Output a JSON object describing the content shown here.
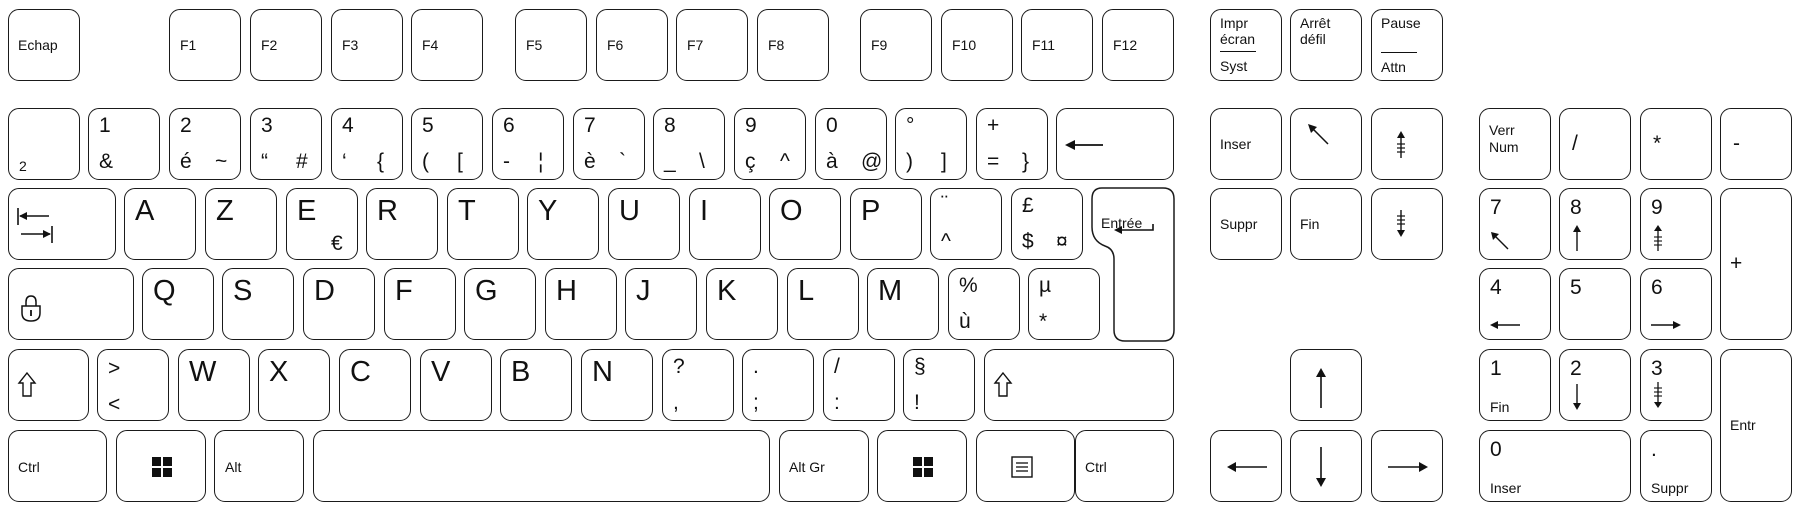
{
  "keyboard": {
    "fn_row": {
      "esc": "Echap",
      "f": [
        "F1",
        "F2",
        "F3",
        "F4",
        "F5",
        "F6",
        "F7",
        "F8",
        "F9",
        "F10",
        "F11",
        "F12"
      ],
      "print_top1": "Impr",
      "print_top2": "écran",
      "print_bottom": "Syst",
      "scroll1": "Arrêt",
      "scroll2": "défil",
      "pause_top": "Pause",
      "pause_bottom": "Attn"
    },
    "number_row": [
      {
        "top": "",
        "bl": "2",
        "br": ""
      },
      {
        "top": "1",
        "bl": "&",
        "br": ""
      },
      {
        "top": "2",
        "bl": "é",
        "br": "~"
      },
      {
        "top": "3",
        "bl": "“",
        "br": "#"
      },
      {
        "top": "4",
        "bl": "‘",
        "br": "{"
      },
      {
        "top": "5",
        "bl": "(",
        "br": "["
      },
      {
        "top": "6",
        "bl": "-",
        "br": "¦"
      },
      {
        "top": "7",
        "bl": "è",
        "br": "`"
      },
      {
        "top": "8",
        "bl": "_",
        "br": "\\"
      },
      {
        "top": "9",
        "bl": "ç",
        "br": "^"
      },
      {
        "top": "0",
        "bl": "à",
        "br": "@"
      },
      {
        "top": "°",
        "bl": ")",
        "br": "]"
      },
      {
        "top": "+",
        "bl": "=",
        "br": "}"
      }
    ],
    "row_azerty": {
      "letters": [
        "A",
        "Z",
        "E",
        "R",
        "T",
        "Y",
        "U",
        "I",
        "O",
        "P"
      ],
      "e_alt": "€",
      "trema_top": "¨",
      "trema_bottom": "^",
      "pound_top": "£",
      "pound_bl": "$",
      "pound_br": "¤",
      "enter": "Entrée"
    },
    "row_qsdf": {
      "letters": [
        "Q",
        "S",
        "D",
        "F",
        "G",
        "H",
        "J",
        "K",
        "L",
        "M"
      ],
      "pct_top": "%",
      "pct_bottom": "ù",
      "mu_top": "µ",
      "mu_bottom": "*"
    },
    "row_wxcv": {
      "angle_top": ">",
      "angle_bottom": "<",
      "letters": [
        "W",
        "X",
        "C",
        "V",
        "B",
        "N"
      ],
      "punct": [
        {
          "top": "?",
          "bottom": ","
        },
        {
          "top": ".",
          "bottom": ";"
        },
        {
          "top": "/",
          "bottom": ":"
        },
        {
          "top": "§",
          "bottom": "!"
        }
      ]
    },
    "bottom_row": {
      "ctrl_left": "Ctrl",
      "alt": "Alt",
      "altgr": "Alt Gr",
      "ctrl_right": "Ctrl"
    },
    "nav": {
      "insert": "Inser",
      "delete": "Suppr",
      "end": "Fin"
    },
    "numpad": {
      "numlock1": "Verr",
      "numlock2": "Num",
      "slash": "/",
      "star": "*",
      "minus": "-",
      "plus": "+",
      "enter": "Entr",
      "n7": "7",
      "n8": "8",
      "n9": "9",
      "n4": "4",
      "n5": "5",
      "n6": "6",
      "n1": "1",
      "n1_sub": "Fin",
      "n2": "2",
      "n3": "3",
      "n0": "0",
      "n0_sub": "Inser",
      "dot": ".",
      "dot_sub": "Suppr"
    }
  }
}
